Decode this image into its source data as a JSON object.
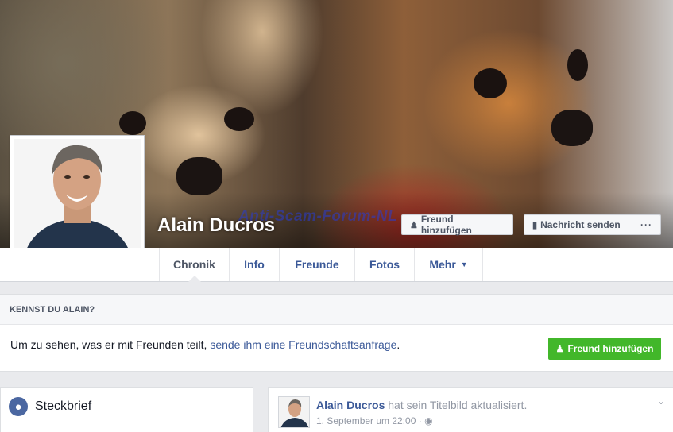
{
  "profile": {
    "name": "Alain Ducros",
    "watermark": "Anti-Scam-Forum-NL"
  },
  "cover_actions": {
    "add_friend_label": "Freund hinzufügen",
    "message_label": "Nachricht senden",
    "more_label": "···"
  },
  "tabs": [
    {
      "label": "Chronik"
    },
    {
      "label": "Info"
    },
    {
      "label": "Freunde"
    },
    {
      "label": "Fotos"
    },
    {
      "label": "Mehr"
    }
  ],
  "know_card": {
    "header": "KENNST DU ALAIN?",
    "text_before": "Um zu sehen, was er mit Freunden teilt, ",
    "link_text": "sende ihm eine Freundschaftsanfrage",
    "text_after": ".",
    "button_label": "Freund hinzufügen"
  },
  "steckbrief": {
    "title": "Steckbrief",
    "icon": "globe-icon"
  },
  "post": {
    "author": "Alain Ducros",
    "action": " hat sein Titelbild aktualisiert.",
    "timestamp": "1. September um 22:00 ·",
    "privacy_icon": "globe-icon"
  },
  "colors": {
    "link": "#3b5998",
    "green_button": "#42b72a",
    "background": "#e9eaed"
  }
}
